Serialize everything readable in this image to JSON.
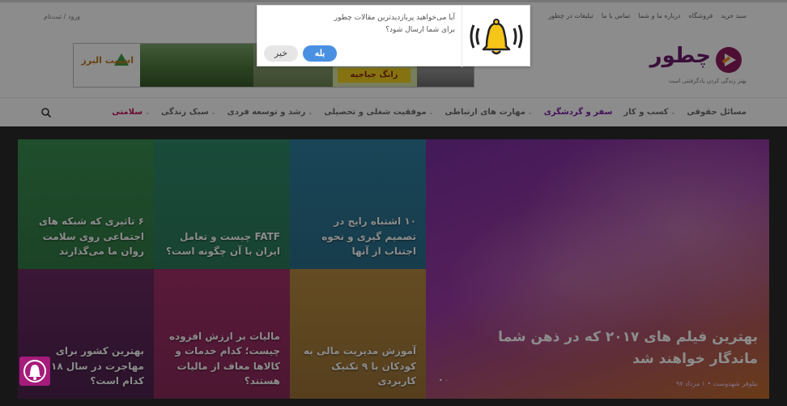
{
  "topbar": {
    "links": [
      "تبلیغات در چطور",
      "تماس با ما",
      "درباره ما و شما",
      "فروشگاه",
      "سبد خرید"
    ],
    "login": "ورود / ثبت‌نام"
  },
  "header": {
    "logo_text": "چطور",
    "tagline": "بهتر زندگی کردن یادگرفتنی است",
    "banner_brand": "اسپیت البرز",
    "banner_tag": "زانگ جباجیه"
  },
  "nav": {
    "items": [
      {
        "label": "سلامتی",
        "has_menu": true
      },
      {
        "label": "سبک زندگی",
        "has_menu": true
      },
      {
        "label": "رشد و توسعه فردی",
        "has_menu": true
      },
      {
        "label": "موفقیت شغلی و تحصیلی",
        "has_menu": true
      },
      {
        "label": "مهارت های ارتباطی",
        "has_menu": true
      },
      {
        "label": "سفر و گردشگری",
        "has_menu": false
      },
      {
        "label": "کسب و کار",
        "has_menu": true
      },
      {
        "label": "مسائل حقوقی",
        "has_menu": false
      }
    ]
  },
  "featured": {
    "headline": "بهترین فیلم های ۲۰۱۷ که در ذهن شما ماندگار خواهند شد",
    "author": "نیلوفر شهدوست",
    "date": "۱ مرداد ۹۷",
    "dots": "• ۰"
  },
  "tiles": [
    {
      "title": "۱۰ اشتباه رایج در تصمیم گیری و نحوه اجتناب از آنها"
    },
    {
      "title": "FATF چیست و تعامل ایران با آن چگونه است؟"
    },
    {
      "title": "۶ تاثیری که شبکه های اجتماعی روی سلامت روان ما می‌گذارند"
    },
    {
      "title": "آموزش مدیریت مالی به کودکان با ۹ تکنیک کاربردی"
    },
    {
      "title": "مالیات بر ارزش افزوده چیست؛ کدام خدمات و کالاها معاف از مالیات هستند؟"
    },
    {
      "title": "بهترین کشور برای مهاجرت در سال ۲۰۱۸ کدام است؟"
    }
  ],
  "popup": {
    "message": "آیا می‌خواهید پربازدیدترین مقالات چطور برای شما ارسال شود؟",
    "yes_label": "بله",
    "no_label": "خیر",
    "bell_icon": "bell-icon"
  },
  "colors": {
    "brand": "#6a1b6b",
    "accent": "#c2185b",
    "button_blue": "#4a90e2"
  }
}
